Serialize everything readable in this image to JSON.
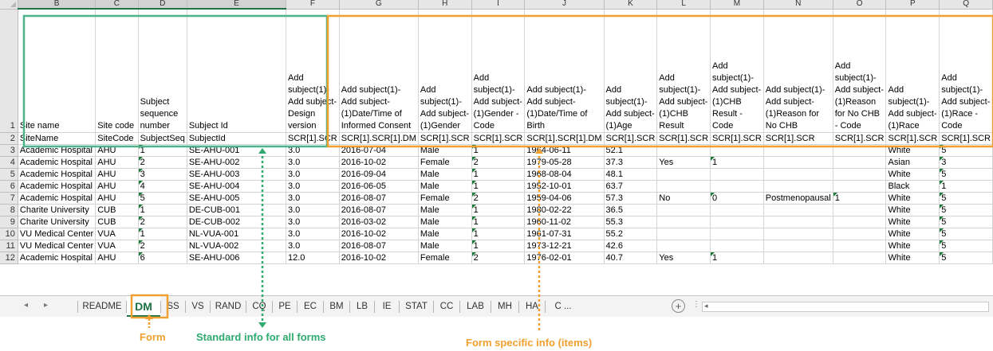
{
  "column_headers": [
    "B",
    "C",
    "D",
    "E",
    "F",
    "G",
    "H",
    "I",
    "J",
    "K",
    "L",
    "M",
    "N",
    "O",
    "P",
    "Q"
  ],
  "row_numbers": [
    "1",
    "2",
    "3",
    "4",
    "5",
    "6",
    "7",
    "8",
    "9",
    "10",
    "11",
    "12"
  ],
  "header_row1": [
    "Site name",
    "Site code",
    "Subject sequence number",
    "Subject Id",
    "Add subject(1)- Add subject- Design version",
    "Add subject(1)- Add subject- (1)Date/Time of Informed Consent",
    "Add subject(1)- Add subject- (1)Gender",
    "Add subject(1)- Add subject- (1)Gender - Code",
    "Add subject(1)- Add subject- (1)Date/Time of Birth",
    "Add subject(1)- Add subject- (1)Age",
    "Add subject(1)- Add subject- (1)CHB Result",
    "Add subject(1)- Add subject- (1)CHB Result - Code",
    "Add subject(1)- Add subject- (1)Reason for No CHB",
    "Add subject(1)- Add subject- (1)Reason for No CHB - Code",
    "Add subject(1)- Add subject- (1)Race",
    "Add subject(1)- Add subject- (1)Race - Code"
  ],
  "header_row2": [
    "SiteName",
    "SiteCode",
    "SubjectSeq",
    "SubjectId",
    "SCR[1].SCR",
    "SCR[1].SCR[1].DM",
    "SCR[1].SCR",
    "SCR[1].SCR",
    "SCR[1].SCR[1].DM",
    "SCR[1].SCR",
    "SCR[1].SCR",
    "SCR[1].SCR",
    "SCR[1].SCR",
    "SCR[1].SCR",
    "SCR[1].SCR",
    "SCR[1].SCR"
  ],
  "rows": [
    [
      "Academic Hospital",
      "AHU",
      "1",
      "SE-AHU-001",
      "3.0",
      "2016-07-04",
      "Male",
      "1",
      "1964-06-11",
      "52.1",
      "",
      "",
      "",
      "",
      "White",
      "5"
    ],
    [
      "Academic Hospital",
      "AHU",
      "2",
      "SE-AHU-002",
      "3.0",
      "2016-10-02",
      "Female",
      "2",
      "1979-05-28",
      "37.3",
      "Yes",
      "1",
      "",
      "",
      "Asian",
      "3"
    ],
    [
      "Academic Hospital",
      "AHU",
      "3",
      "SE-AHU-003",
      "3.0",
      "2016-09-04",
      "Male",
      "1",
      "1968-08-04",
      "48.1",
      "",
      "",
      "",
      "",
      "White",
      "5"
    ],
    [
      "Academic Hospital",
      "AHU",
      "4",
      "SE-AHU-004",
      "3.0",
      "2016-06-05",
      "Male",
      "1",
      "1952-10-01",
      "63.7",
      "",
      "",
      "",
      "",
      "Black",
      "1"
    ],
    [
      "Academic Hospital",
      "AHU",
      "5",
      "SE-AHU-005",
      "3.0",
      "2016-08-07",
      "Female",
      "2",
      "1959-04-06",
      "57.3",
      "No",
      "0",
      "Postmenopausal",
      "1",
      "White",
      "5"
    ],
    [
      "Charite University",
      "CUB",
      "1",
      "DE-CUB-001",
      "3.0",
      "2016-08-07",
      "Male",
      "1",
      "1980-02-22",
      "36.5",
      "",
      "",
      "",
      "",
      "White",
      "5"
    ],
    [
      "Charite University",
      "CUB",
      "2",
      "DE-CUB-002",
      "3.0",
      "2016-03-02",
      "Male",
      "1",
      "1960-11-02",
      "55.3",
      "",
      "",
      "",
      "",
      "White",
      "5"
    ],
    [
      "VU Medical Center",
      "VUA",
      "1",
      "NL-VUA-001",
      "3.0",
      "2016-10-02",
      "Male",
      "1",
      "1961-07-31",
      "55.2",
      "",
      "",
      "",
      "",
      "White",
      "5"
    ],
    [
      "VU Medical Center",
      "VUA",
      "2",
      "NL-VUA-002",
      "3.0",
      "2016-08-07",
      "Male",
      "1",
      "1973-12-21",
      "42.6",
      "",
      "",
      "",
      "",
      "White",
      "5"
    ],
    [
      "Academic Hospital",
      "AHU",
      "6",
      "SE-AHU-006",
      "12.0",
      "2016-10-02",
      "Female",
      "2",
      "1976-02-01",
      "40.7",
      "Yes",
      "1",
      "",
      "",
      "White",
      "5"
    ]
  ],
  "sheet_tabs": [
    "README",
    "DM",
    "SS",
    "VS",
    "RAND",
    "CQ",
    "PE",
    "EC",
    "BM",
    "LB",
    "IE",
    "STAT",
    "CC",
    "LAB",
    "MH",
    "HA",
    "C ..."
  ],
  "active_tab": "DM",
  "add_sheet_label": "+",
  "nav_next": "▸",
  "nav_prev": "◂",
  "more_label": "⋮",
  "scroll_left": "◂",
  "callouts": {
    "form": "Form",
    "standard": "Standard info for all forms",
    "specific": "Form specific info (items)"
  },
  "colors": {
    "accent_green": "#217346",
    "callout_orange": "#f0a030",
    "callout_green": "#2eaa6e"
  }
}
